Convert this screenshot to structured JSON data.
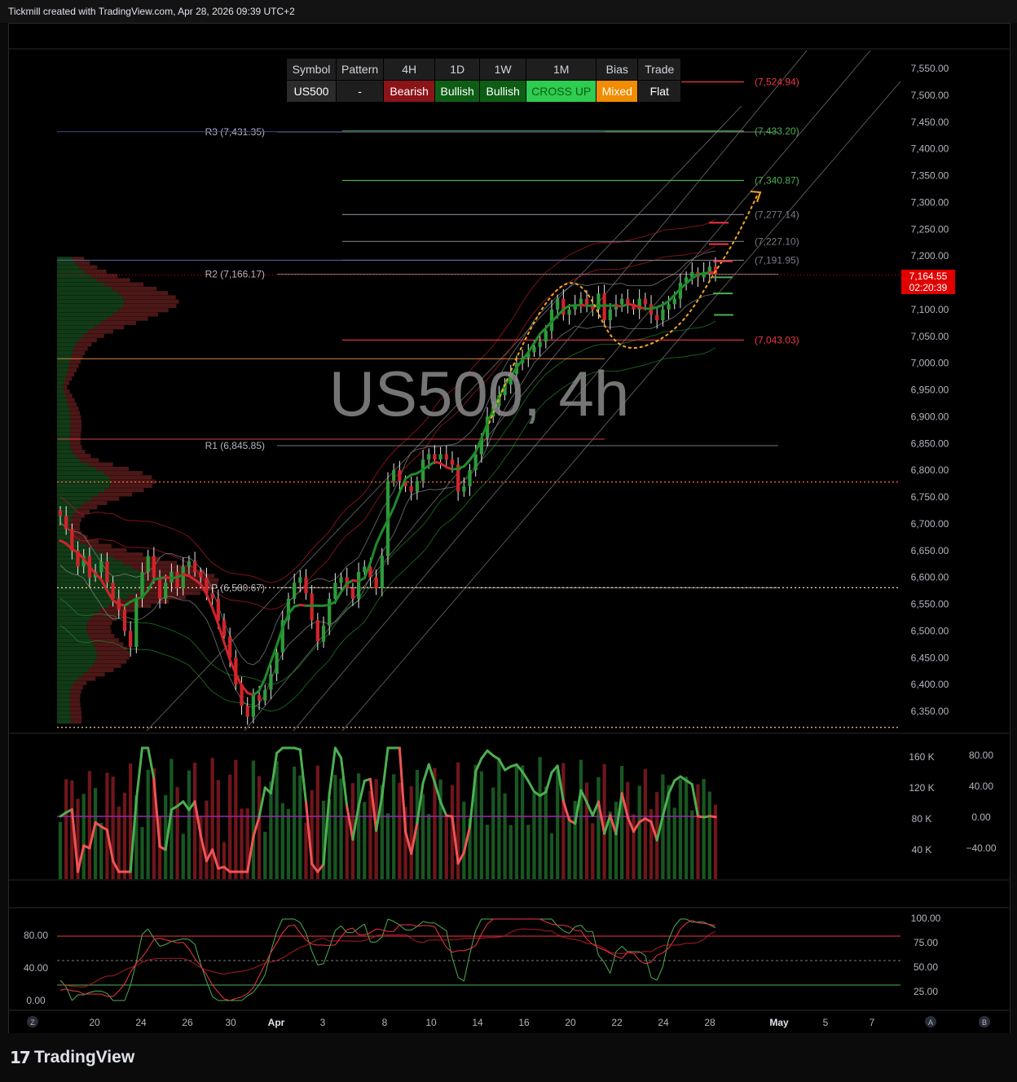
{
  "header": {
    "text": "Tickmill created with TradingView.com, Apr 28, 2026 09:39 UTC+2"
  },
  "watermark": "US500, 4h",
  "table": {
    "headers": [
      "Symbol",
      "Pattern",
      "4H",
      "1D",
      "1W",
      "1M",
      "Bias",
      "Trade"
    ],
    "values": [
      "US500",
      "-",
      "Bearish",
      "Bullish",
      "Bullish",
      "CROSS UP",
      "Mixed",
      "Flat"
    ]
  },
  "price_tag": {
    "price": "7,164.55",
    "countdown": "02:20:39"
  },
  "footer": {
    "logo_text": "TradingView"
  },
  "colors": {
    "bull": "#1f8a2a",
    "bear": "#b81c22",
    "background": "#000000",
    "price_tag": "#e00000"
  },
  "chart_data": [
    {
      "type": "candlestick",
      "y_ticks": [
        "7,550.00",
        "7,500.00",
        "7,450.00",
        "7,400.00",
        "7,350.00",
        "7,300.00",
        "7,250.00",
        "7,200.00",
        "7,150.00",
        "7,100.00",
        "7,050.00",
        "7,000.00",
        "6,950.00",
        "6,900.00",
        "6,850.00",
        "6,800.00",
        "6,750.00",
        "6,700.00",
        "6,650.00",
        "6,600.00",
        "6,550.00",
        "6,500.00",
        "6,450.00",
        "6,400.00",
        "6,350.00"
      ],
      "ylim": [
        6320,
        7570
      ],
      "x_ticks": [
        "20",
        "24",
        "26",
        "30",
        "Apr",
        "3",
        "8",
        "10",
        "14",
        "16",
        "20",
        "22",
        "24",
        "28",
        "May",
        "5",
        "7"
      ],
      "corner_labels": {
        "left": "Z",
        "a": "A",
        "b": "B"
      },
      "levels_left": [
        {
          "label": "R3 (7,431.35)",
          "value": 7431.35
        },
        {
          "label": "R2 (7,166.17)",
          "value": 7166.17
        },
        {
          "label": "R1 (6,845.85)",
          "value": 6845.85
        },
        {
          "label": "P (6,580.67)",
          "value": 6580.67
        }
      ],
      "levels_right": [
        {
          "label": "(7,524.94)",
          "value": 7524.94,
          "color": "#f23645"
        },
        {
          "label": "(7,433.20)",
          "value": 7433.2,
          "color": "#4caf50"
        },
        {
          "label": "(7,340.87)",
          "value": 7340.87,
          "color": "#4caf50"
        },
        {
          "label": "(7,277.14)",
          "value": 7277.14,
          "color": "#787b86"
        },
        {
          "label": "(7,227.10)",
          "value": 7227.1,
          "color": "#787b86"
        },
        {
          "label": "(7,191.95)",
          "value": 7191.95,
          "color": "#787b86"
        },
        {
          "label": "(7,043.03)",
          "value": 7043.03,
          "color": "#f23645"
        }
      ],
      "closes": [
        6715,
        6690,
        6650,
        6620,
        6640,
        6600,
        6610,
        6630,
        6590,
        6560,
        6540,
        6500,
        6470,
        6560,
        6610,
        6640,
        6600,
        6560,
        6590,
        6610,
        6580,
        6620,
        6630,
        6610,
        6600,
        6570,
        6560,
        6520,
        6490,
        6450,
        6400,
        6360,
        6340,
        6380,
        6370,
        6390,
        6420,
        6460,
        6520,
        6560,
        6590,
        6600,
        6570,
        6520,
        6480,
        6510,
        6560,
        6590,
        6600,
        6580,
        6560,
        6610,
        6620,
        6600,
        6580,
        6640,
        6780,
        6800,
        6780,
        6770,
        6760,
        6780,
        6820,
        6830,
        6820,
        6830,
        6820,
        6810,
        6760,
        6770,
        6800,
        6830,
        6860,
        6900,
        6920,
        6940,
        6960,
        6980,
        7000,
        7010,
        7020,
        7030,
        7040,
        7060,
        7100,
        7120,
        7090,
        7100,
        7110,
        7120,
        7110,
        7100,
        7130,
        7080,
        7100,
        7110,
        7120,
        7110,
        7100,
        7120,
        7110,
        7090,
        7080,
        7100,
        7110,
        7120,
        7150,
        7160,
        7170,
        7160,
        7170,
        7180,
        7165
      ]
    },
    {
      "type": "bar",
      "series": [
        {
          "name": "",
          "values": []
        }
      ],
      "volume_ticks": [
        "160 K",
        "120 K",
        "80 K",
        "40 K"
      ],
      "rsi_ticks": [
        "80.00",
        "40.00",
        "0.00",
        "−40.00"
      ]
    },
    {
      "type": "line",
      "ticks_right": [
        "100.00",
        "75.00",
        "50.00",
        "25.00"
      ],
      "ticks_left": [
        "80.00",
        "40.00",
        "0.00"
      ],
      "ylim": [
        0,
        100
      ]
    }
  ]
}
